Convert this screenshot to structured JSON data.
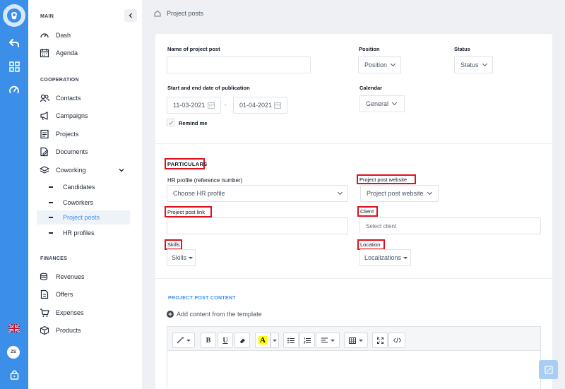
{
  "sidebar": {
    "main_title": "MAIN",
    "main_items": [
      {
        "label": "Dash"
      },
      {
        "label": "Agenda"
      }
    ],
    "coop_title": "COOPERATION",
    "coop_items": [
      {
        "label": "Contacts"
      },
      {
        "label": "Campaigns"
      },
      {
        "label": "Projects"
      },
      {
        "label": "Documents"
      },
      {
        "label": "Coworking"
      }
    ],
    "coworking_sub": [
      {
        "label": "Candidates"
      },
      {
        "label": "Coworkers"
      },
      {
        "label": "Project posts",
        "active": true
      },
      {
        "label": "HR profiles"
      }
    ],
    "fin_title": "FINANCES",
    "fin_items": [
      {
        "label": "Revenues"
      },
      {
        "label": "Offers"
      },
      {
        "label": "Expenses"
      },
      {
        "label": "Products"
      }
    ]
  },
  "rail": {
    "avatar_initials": "ZS"
  },
  "breadcrumb": {
    "label": "Project posts"
  },
  "form": {
    "name_label": "Name of project post",
    "name_value": "",
    "position_label": "Position",
    "position_value": "Position",
    "status_label": "Status",
    "status_value": "Status",
    "dates_label": "Start and end date of publication",
    "start_date": "11-03-2021",
    "date_separator": "-",
    "end_date": "01-04-2021",
    "calendar_label": "Calendar",
    "calendar_value": "General",
    "remind_label": "Remind me",
    "remind_checked": true
  },
  "particulars": {
    "heading": "PARTICULARS",
    "hr_label": "HR profile (reference number)",
    "hr_value": "Choose HR profile",
    "website_label": "Project post website",
    "website_value": "Project post website",
    "link_label": "Project post link",
    "link_value": "",
    "client_label": "Client",
    "client_placeholder": "Select client",
    "skills_label": "Skills",
    "skills_value": "Skills",
    "location_label": "Location",
    "location_value": "Localizations"
  },
  "content": {
    "heading": "PROJECT POST CONTENT",
    "add_template": "Add content from the template"
  },
  "colors": {
    "accent": "#3b8fe8",
    "highlight_box": "#e0111a",
    "font_color_swatch": "#ffff00"
  }
}
